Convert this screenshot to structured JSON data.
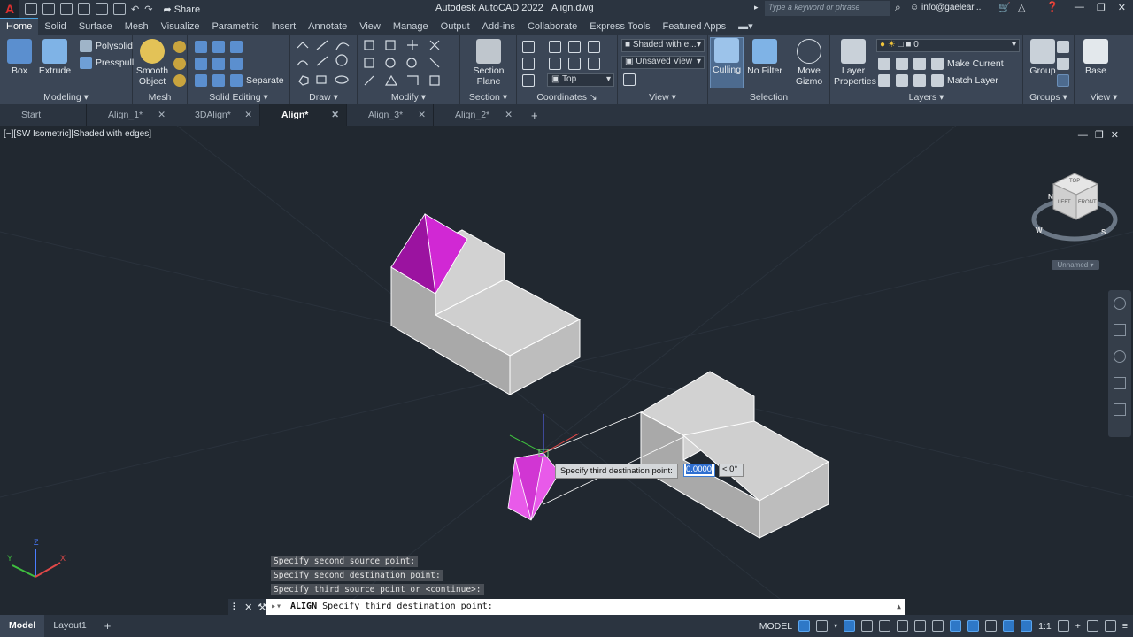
{
  "app": {
    "logo": "A",
    "title": "Autodesk AutoCAD 2022",
    "file": "Align.dwg",
    "share": "Share",
    "search_placeholder": "Type a keyword or phrase",
    "user": "info@gaelear..."
  },
  "ribbon_tabs": [
    "Home",
    "Solid",
    "Surface",
    "Mesh",
    "Visualize",
    "Parametric",
    "Insert",
    "Annotate",
    "View",
    "Manage",
    "Output",
    "Add-ins",
    "Collaborate",
    "Express Tools",
    "Featured Apps"
  ],
  "ribbon": {
    "modeling": {
      "title": "Modeling",
      "box": "Box",
      "extrude": "Extrude",
      "polysolid": "Polysolid",
      "presspull": "Presspull"
    },
    "mesh": {
      "title": "Mesh",
      "smooth1": "Smooth",
      "smooth2": "Object"
    },
    "solid_editing": {
      "title": "Solid Editing",
      "separate": "Separate"
    },
    "draw": {
      "title": "Draw"
    },
    "modify": {
      "title": "Modify"
    },
    "section": {
      "title": "Section",
      "btn1": "Section",
      "btn2": "Plane"
    },
    "coordinates": {
      "title": "Coordinates",
      "ucs": "Top"
    },
    "view": {
      "title": "View",
      "visual_style": "Shaded with e...",
      "named_view": "Unsaved View"
    },
    "selection": {
      "title": "Selection",
      "culling": "Culling",
      "nofilter": "No Filter",
      "gizmo1": "Move",
      "gizmo2": "Gizmo"
    },
    "layers": {
      "title": "Layers",
      "layer_props1": "Layer",
      "layer_props2": "Properties",
      "current_layer": "0",
      "make_current": "Make Current",
      "match_layer": "Match Layer"
    },
    "groups": {
      "title": "Groups",
      "group": "Group"
    },
    "view2": {
      "title": "View",
      "base": "Base"
    }
  },
  "doc_tabs": [
    {
      "label": "Start",
      "active": false,
      "closable": false
    },
    {
      "label": "Align_1*",
      "active": false,
      "closable": true
    },
    {
      "label": "3DAlign*",
      "active": false,
      "closable": true
    },
    {
      "label": "Align*",
      "active": true,
      "closable": true
    },
    {
      "label": "Align_3*",
      "active": false,
      "closable": true
    },
    {
      "label": "Align_2*",
      "active": false,
      "closable": true
    }
  ],
  "viewport": {
    "label": "[−][SW Isometric][Shaded with edges]",
    "viewcube": {
      "top": "TOP",
      "left": "LEFT",
      "front": "FRONT",
      "compass": [
        "N",
        "W",
        "S"
      ]
    },
    "ucs_name": "Unnamed",
    "ucs_axes": [
      "Z",
      "Y",
      "X"
    ]
  },
  "dynamic_input": {
    "prompt": "Specify third destination point:",
    "value": "0.0000",
    "angle": "< 0°"
  },
  "command_history": [
    "Specify second source point:",
    "Specify second destination point:",
    "Specify third source point or <continue>:"
  ],
  "command_line": {
    "command": "ALIGN",
    "prompt": "Specify third destination point:"
  },
  "layout_tabs": [
    "Model",
    "Layout1"
  ],
  "status": {
    "model": "MODEL",
    "scale": "1:1"
  },
  "colors": {
    "accent": "#2e78c7",
    "magenta": "#d21fd2",
    "solid_face": "#bfbfbf"
  }
}
